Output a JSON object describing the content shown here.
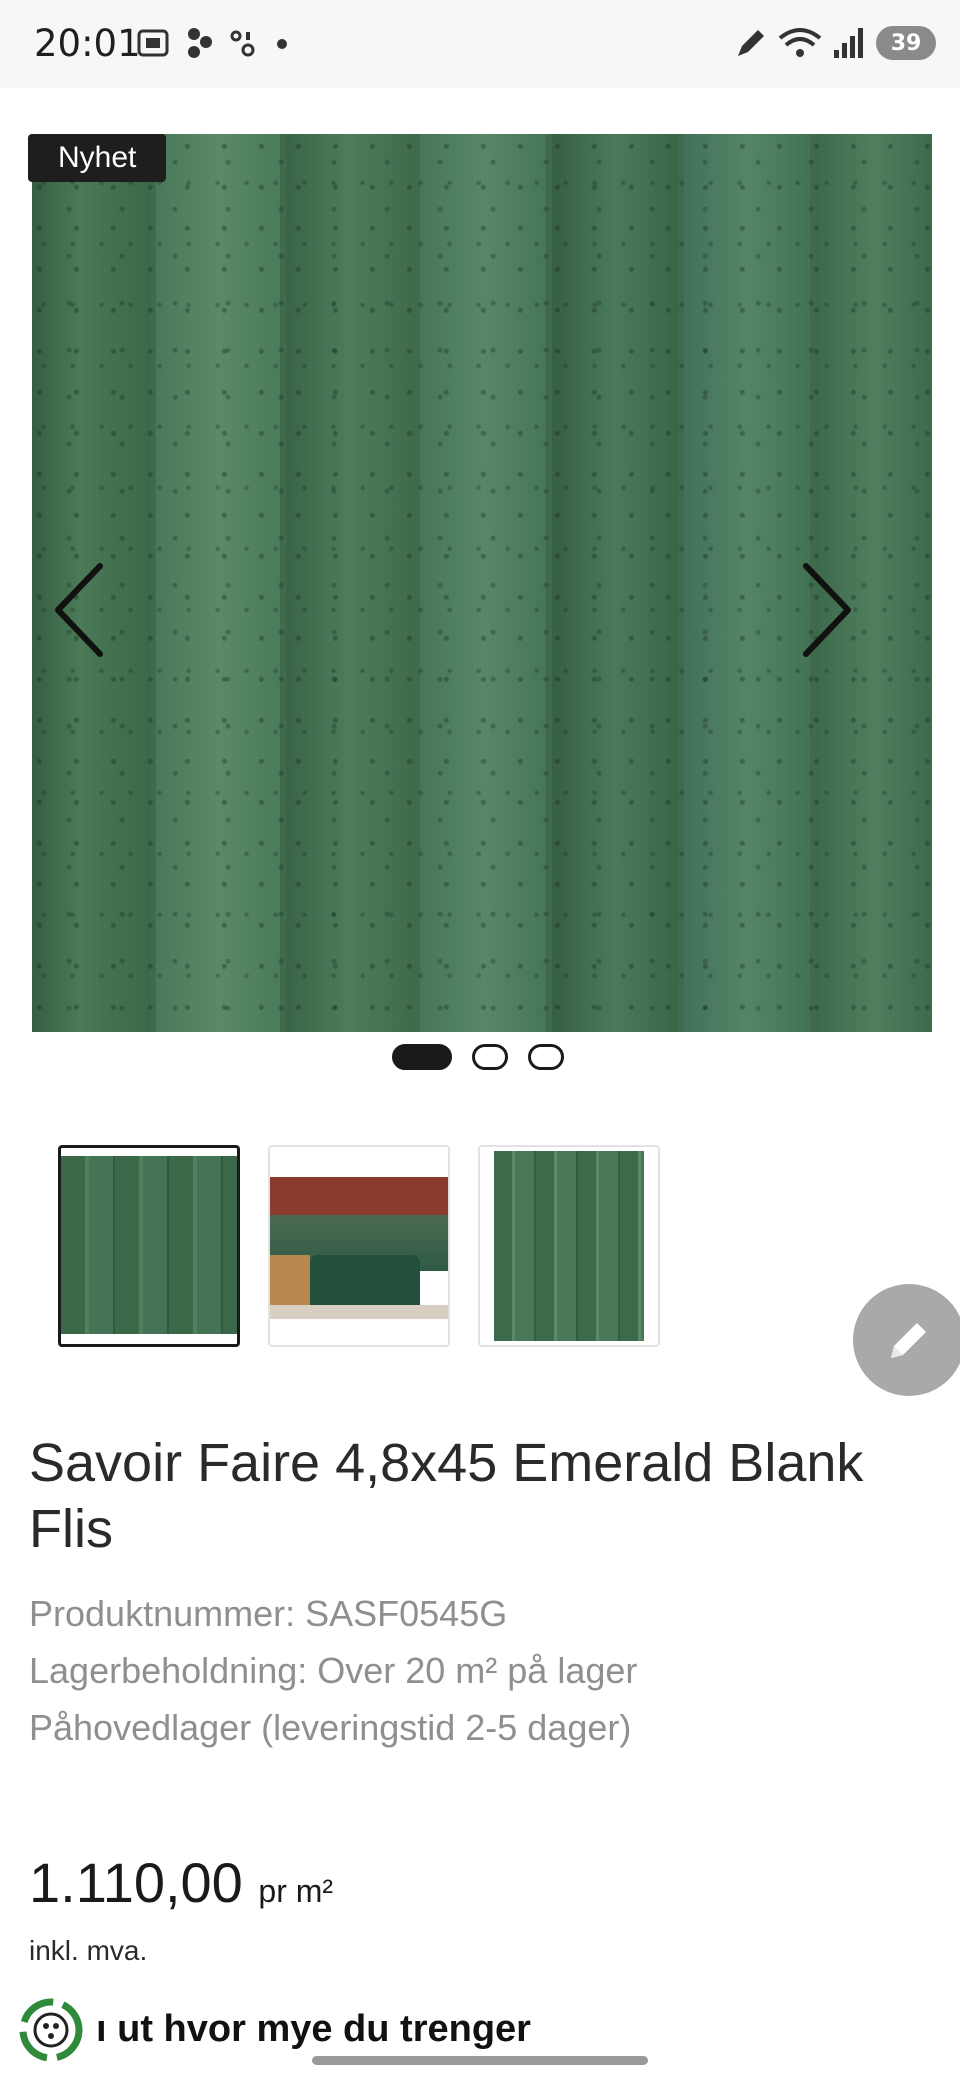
{
  "status_bar": {
    "time": "20:01",
    "battery": "39",
    "icons_left": [
      "screenshot-icon",
      "app-icon",
      "app-icon",
      "dot-icon"
    ],
    "icons_right": [
      "pen-icon",
      "wifi-icon",
      "signal-icon",
      "battery-icon"
    ]
  },
  "gallery": {
    "badge": "Nyhet",
    "prev_icon": "chevron-left-icon",
    "next_icon": "chevron-right-icon",
    "pages": 3,
    "active_page": 1,
    "thumbnails": [
      "green-tile-closeup",
      "kitchen-interior",
      "green-tile-full"
    ]
  },
  "edit_button_icon": "pencil-icon",
  "product": {
    "title": "Savoir Faire 4,8x45 Emerald Blank Flis",
    "product_number": "Produktnummer: SASF0545G",
    "stock": "Lagerbeholdning: Over 20 m² på lager",
    "warehouse": "Påhovedlager (leveringstid 2-5 dager)",
    "price": "1.110,00",
    "price_unit": "pr m²",
    "vat_note": "inkl. mva."
  },
  "calculator": {
    "label": "ı ut hvor mye du trenger",
    "icon": "recycle-calculator-icon"
  },
  "colors": {
    "tile_green": "#3f6a4c",
    "badge_bg": "#1e1e1e",
    "fab_bg": "#a9a9a9",
    "meta_text": "#8f8f8f",
    "accent_green": "#2f8a3a"
  }
}
